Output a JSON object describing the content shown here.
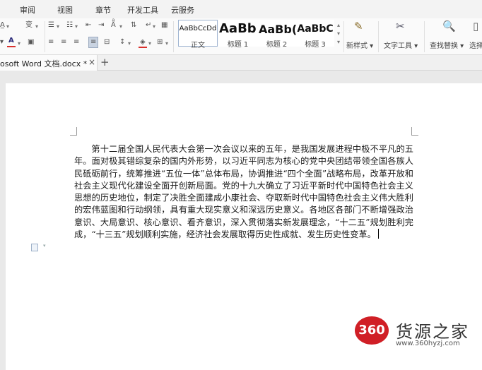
{
  "menu": {
    "tabs": [
      "审阅",
      "视图",
      "章节",
      "开发工具",
      "云服务"
    ]
  },
  "ribbon": {
    "styles": [
      {
        "sample": "AaBbCcDd",
        "label": "正文"
      },
      {
        "sample": "AaBb",
        "label": "标题 1"
      },
      {
        "sample": "AaBb(",
        "label": "标题 2"
      },
      {
        "sample": "AaBbC",
        "label": "标题 3"
      }
    ],
    "new_style": "新样式",
    "text_tools": "文字工具",
    "find_replace": "查找替换",
    "select": "选择"
  },
  "tabbar": {
    "doc_title": "osoft Word 文档.docx *",
    "close": "×",
    "new_tab": "+"
  },
  "document": {
    "paragraph": "第十二届全国人民代表大会第一次会议以来的五年，是我国发展进程中极不平凡的五年。面对极其错综复杂的国内外形势，以习近平同志为核心的党中央团结带领全国各族人民砥砺前行，统筹推进“五位一体”总体布局，协调推进“四个全面”战略布局，改革开放和社会主义现代化建设全面开创新局面。党的十九大确立了习近平新时代中国特色社会主义思想的历史地位，制定了决胜全面建成小康社会、夺取新时代中国特色社会主义伟大胜利的宏伟蓝图和行动纲领，具有重大现实意义和深远历史意义。各地区各部门不断增强政治意识、大局意识、核心意识、看齐意识，深入贯彻落实新发展理念，“十二五”规划胜利完成，“十三五”规划顺利实施，经济社会发展取得历史性成就、发生历史性变革。"
  },
  "watermark": {
    "logo": "360",
    "name": "货源之家",
    "url": "www.360hyzj.com"
  },
  "colors": {
    "font_color_bar": "#d9302c",
    "highlight_bar": "#e8c930",
    "shading_bar": "#d9302c",
    "watermark_red": "#d01f26"
  }
}
